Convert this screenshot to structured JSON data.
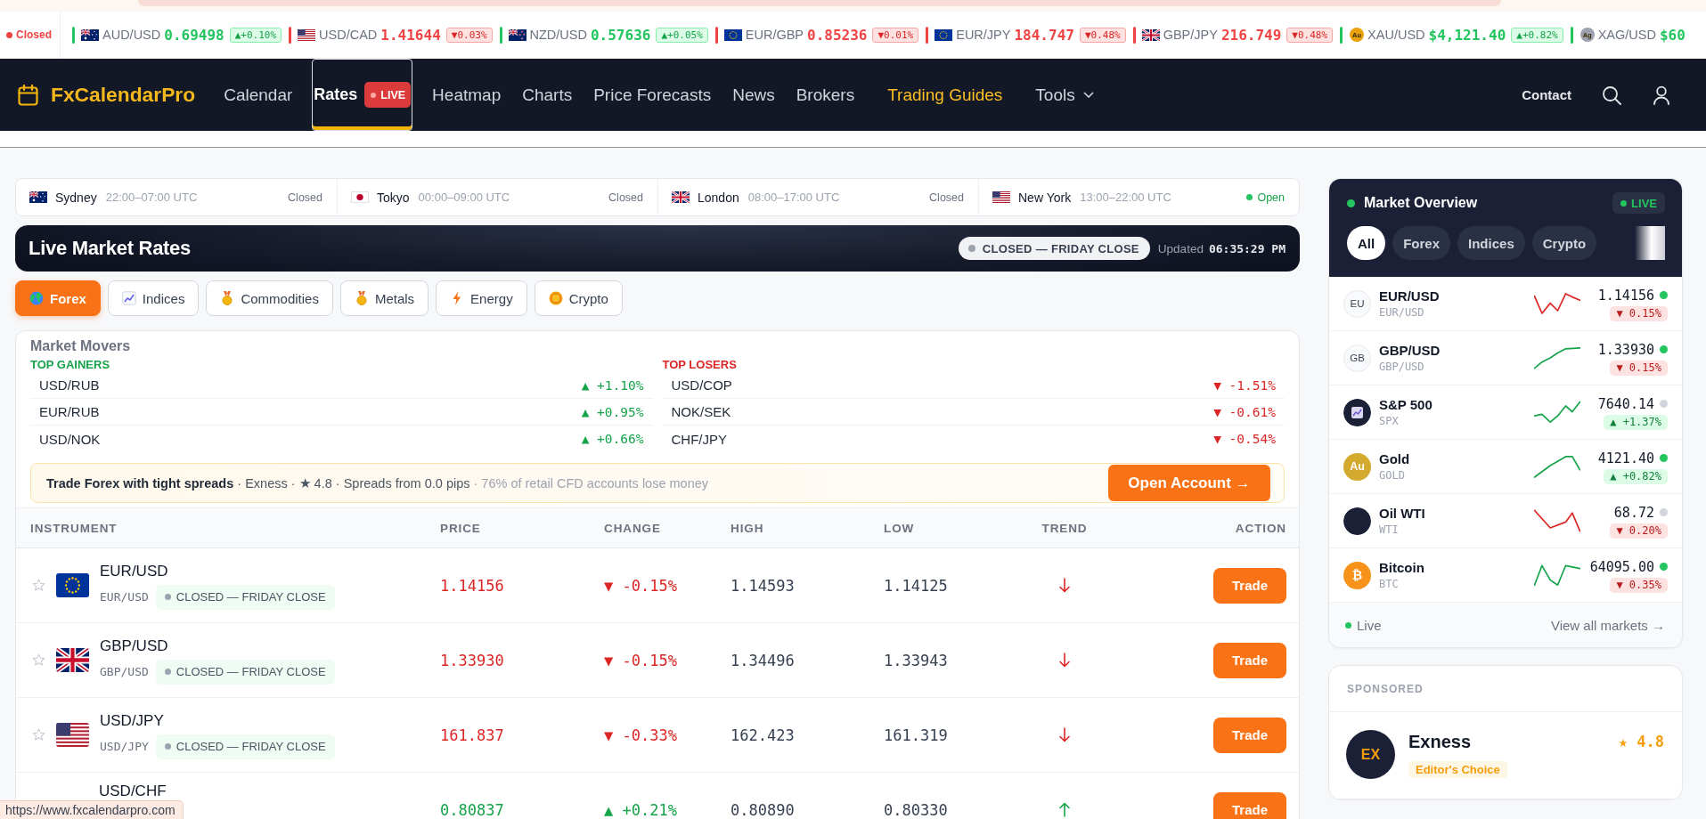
{
  "ticker": {
    "status": {
      "label": "Closed",
      "open": false
    },
    "items": [
      {
        "kind": "au",
        "pair": "AUD/USD",
        "price": "0.69498",
        "change": "▲+0.10%",
        "rising": true
      },
      {
        "kind": "us",
        "pair": "USD/CAD",
        "price": "1.41644",
        "change": "▼0.03%",
        "rising": false
      },
      {
        "kind": "nz",
        "pair": "NZD/USD",
        "price": "0.57636",
        "change": "▲+0.05%",
        "rising": true
      },
      {
        "kind": "eu",
        "pair": "EUR/GBP",
        "price": "0.85236",
        "change": "▼0.01%",
        "rising": false
      },
      {
        "kind": "eu",
        "pair": "EUR/JPY",
        "price": "184.747",
        "change": "▼0.48%",
        "rising": false
      },
      {
        "kind": "gb",
        "pair": "GBP/JPY",
        "price": "216.749",
        "change": "▼0.48%",
        "rising": false
      },
      {
        "kind": "coin",
        "coin": {
          "text": "Au",
          "color": "#e9a20c"
        },
        "pair": "XAU/USD",
        "price": "$4,121.40",
        "change": "▲+0.82%",
        "rising": true
      },
      {
        "kind": "coin",
        "coin": {
          "text": "Ag",
          "color": "#9ca3af"
        },
        "pair": "XAG/USD",
        "price": "$60",
        "rising": true
      }
    ]
  },
  "nav": {
    "logo": "FxCalendarPro",
    "items": [
      {
        "label": "Calendar",
        "kind": "link",
        "selected": false
      },
      {
        "label": "Rates",
        "kind": "link",
        "selected": true,
        "badge": "LIVE"
      },
      {
        "label": "Heatmap",
        "kind": "link",
        "selected": false
      },
      {
        "label": "Charts",
        "kind": "link",
        "selected": false
      },
      {
        "label": "Price Forecasts",
        "kind": "link",
        "selected": false
      },
      {
        "label": "News",
        "kind": "link",
        "selected": false
      },
      {
        "label": "Brokers",
        "kind": "link",
        "selected": false
      },
      {
        "label": "Trading Guides",
        "kind": "featured",
        "selected": false
      },
      {
        "label": "Tools",
        "kind": "dropdown",
        "selected": false
      }
    ],
    "contact": "Contact"
  },
  "sessions": [
    {
      "kind": "au",
      "city": "Sydney",
      "hours": "22:00–07:00 UTC",
      "status": "Closed",
      "open": false
    },
    {
      "kind": "jp",
      "city": "Tokyo",
      "hours": "00:00–09:00 UTC",
      "status": "Closed",
      "open": false
    },
    {
      "kind": "gb",
      "city": "London",
      "hours": "08:00–17:00 UTC",
      "status": "Closed",
      "open": false
    },
    {
      "kind": "us",
      "city": "New York",
      "hours": "13:00–22:00 UTC",
      "status": "Open",
      "open": true
    }
  ],
  "rates_header": {
    "title": "Live Market Rates",
    "market_status": "CLOSED — FRIDAY CLOSE",
    "updated_label": "Updated",
    "updated_time": "06:35:29 PM"
  },
  "categories": [
    {
      "label": "Forex",
      "kind": "globe",
      "selected": true
    },
    {
      "label": "Indices",
      "kind": "chart",
      "selected": false
    },
    {
      "label": "Commodities",
      "kind": "medal",
      "selected": false
    },
    {
      "label": "Metals",
      "kind": "medal",
      "selected": false
    },
    {
      "label": "Energy",
      "kind": "bolt",
      "selected": false
    },
    {
      "label": "Crypto",
      "kind": "coin",
      "selected": false
    }
  ],
  "movers": {
    "title": "Market Movers",
    "groups": [
      {
        "label": "TOP GAINERS",
        "rising": true,
        "items": [
          {
            "pair": "USD/RUB",
            "change": "▲ +1.10%"
          },
          {
            "pair": "EUR/RUB",
            "change": "▲ +0.95%"
          },
          {
            "pair": "USD/NOK",
            "change": "▲ +0.66%"
          }
        ]
      },
      {
        "label": "TOP LOSERS",
        "rising": false,
        "items": [
          {
            "pair": "USD/COP",
            "change": "▼ -1.51%"
          },
          {
            "pair": "NOK/SEK",
            "change": "▼ -0.61%"
          },
          {
            "pair": "CHF/JPY",
            "change": "▼ -0.54%"
          }
        ]
      }
    ]
  },
  "promo": {
    "headline": "Trade Forex with tight spreads",
    "details": "· Exness · ★ 4.8 · Spreads from 0.0 pips",
    "risk": "· 76% of retail CFD accounts lose money",
    "button": "Open Account →"
  },
  "table": {
    "columns": [
      "INSTRUMENT",
      "PRICE",
      "CHANGE",
      "HIGH",
      "LOW",
      "TREND",
      "ACTION"
    ],
    "rows": [
      {
        "favorite": false,
        "kind": "eu",
        "name": "EUR/USD",
        "symbol": "EUR/USD",
        "status": "CLOSED — FRIDAY CLOSE",
        "price": "1.14156",
        "change": "▼ -0.15%",
        "high": "1.14593",
        "low": "1.14125",
        "rising": false,
        "action": "Trade"
      },
      {
        "favorite": false,
        "kind": "gb",
        "name": "GBP/USD",
        "symbol": "GBP/USD",
        "status": "CLOSED — FRIDAY CLOSE",
        "price": "1.33930",
        "change": "▼ -0.15%",
        "high": "1.34496",
        "low": "1.33943",
        "rising": false,
        "action": "Trade"
      },
      {
        "favorite": false,
        "kind": "us",
        "name": "USD/JPY",
        "symbol": "USD/JPY",
        "status": "CLOSED — FRIDAY CLOSE",
        "price": "161.837",
        "change": "▼ -0.33%",
        "high": "162.423",
        "low": "161.319",
        "rising": false,
        "action": "Trade"
      },
      {
        "name": "USD/CHF",
        "price": "0.80837",
        "change": "▲ +0.21%",
        "high": "0.80890",
        "low": "0.80330",
        "rising": true,
        "action": "Trade"
      }
    ]
  },
  "overview": {
    "title": "Market Overview",
    "live_badge": "LIVE",
    "filters": [
      {
        "label": "All",
        "selected": true
      },
      {
        "label": "Forex",
        "selected": false
      },
      {
        "label": "Indices",
        "selected": false
      },
      {
        "label": "Crypto",
        "selected": false
      }
    ],
    "rows": [
      {
        "kind": "currency",
        "badge": "EU",
        "name": "EUR/USD",
        "symbol": "EUR/USD",
        "price": "1.14156",
        "live": true,
        "change": "▼ 0.15%",
        "rising": false,
        "sparkline_rising": false
      },
      {
        "kind": "currency",
        "badge": "GB",
        "name": "GBP/USD",
        "symbol": "GBP/USD",
        "price": "1.33930",
        "live": true,
        "change": "▼ 0.15%",
        "rising": false,
        "sparkline_rising": true
      },
      {
        "kind": "index",
        "name": "S&P 500",
        "symbol": "SPX",
        "price": "7640.14",
        "live": false,
        "change": "▲ +1.37%",
        "rising": true,
        "sparkline_rising": true
      },
      {
        "kind": "metal",
        "badge": "Au",
        "name": "Gold",
        "symbol": "GOLD",
        "price": "4121.40",
        "live": true,
        "change": "▲ +0.82%",
        "rising": true,
        "sparkline_rising": true
      },
      {
        "kind": "commodity",
        "name": "Oil WTI",
        "symbol": "WTI",
        "price": "68.72",
        "live": false,
        "change": "▼ 0.20%",
        "rising": false,
        "sparkline_rising": false
      },
      {
        "kind": "crypto",
        "badge": "₿",
        "name": "Bitcoin",
        "symbol": "BTC",
        "price": "64095.00",
        "live": true,
        "change": "▼ 0.35%",
        "rising": false,
        "sparkline_rising": true
      }
    ],
    "footer_status": "Live",
    "footer_link": "View all markets →"
  },
  "sponsored": {
    "label": "SPONSORED",
    "logo": "EX",
    "name": "Exness",
    "tag": "Editor's Choice",
    "rating": "★ 4.8"
  },
  "status_url": "https://www.fxcalendarpro.com"
}
